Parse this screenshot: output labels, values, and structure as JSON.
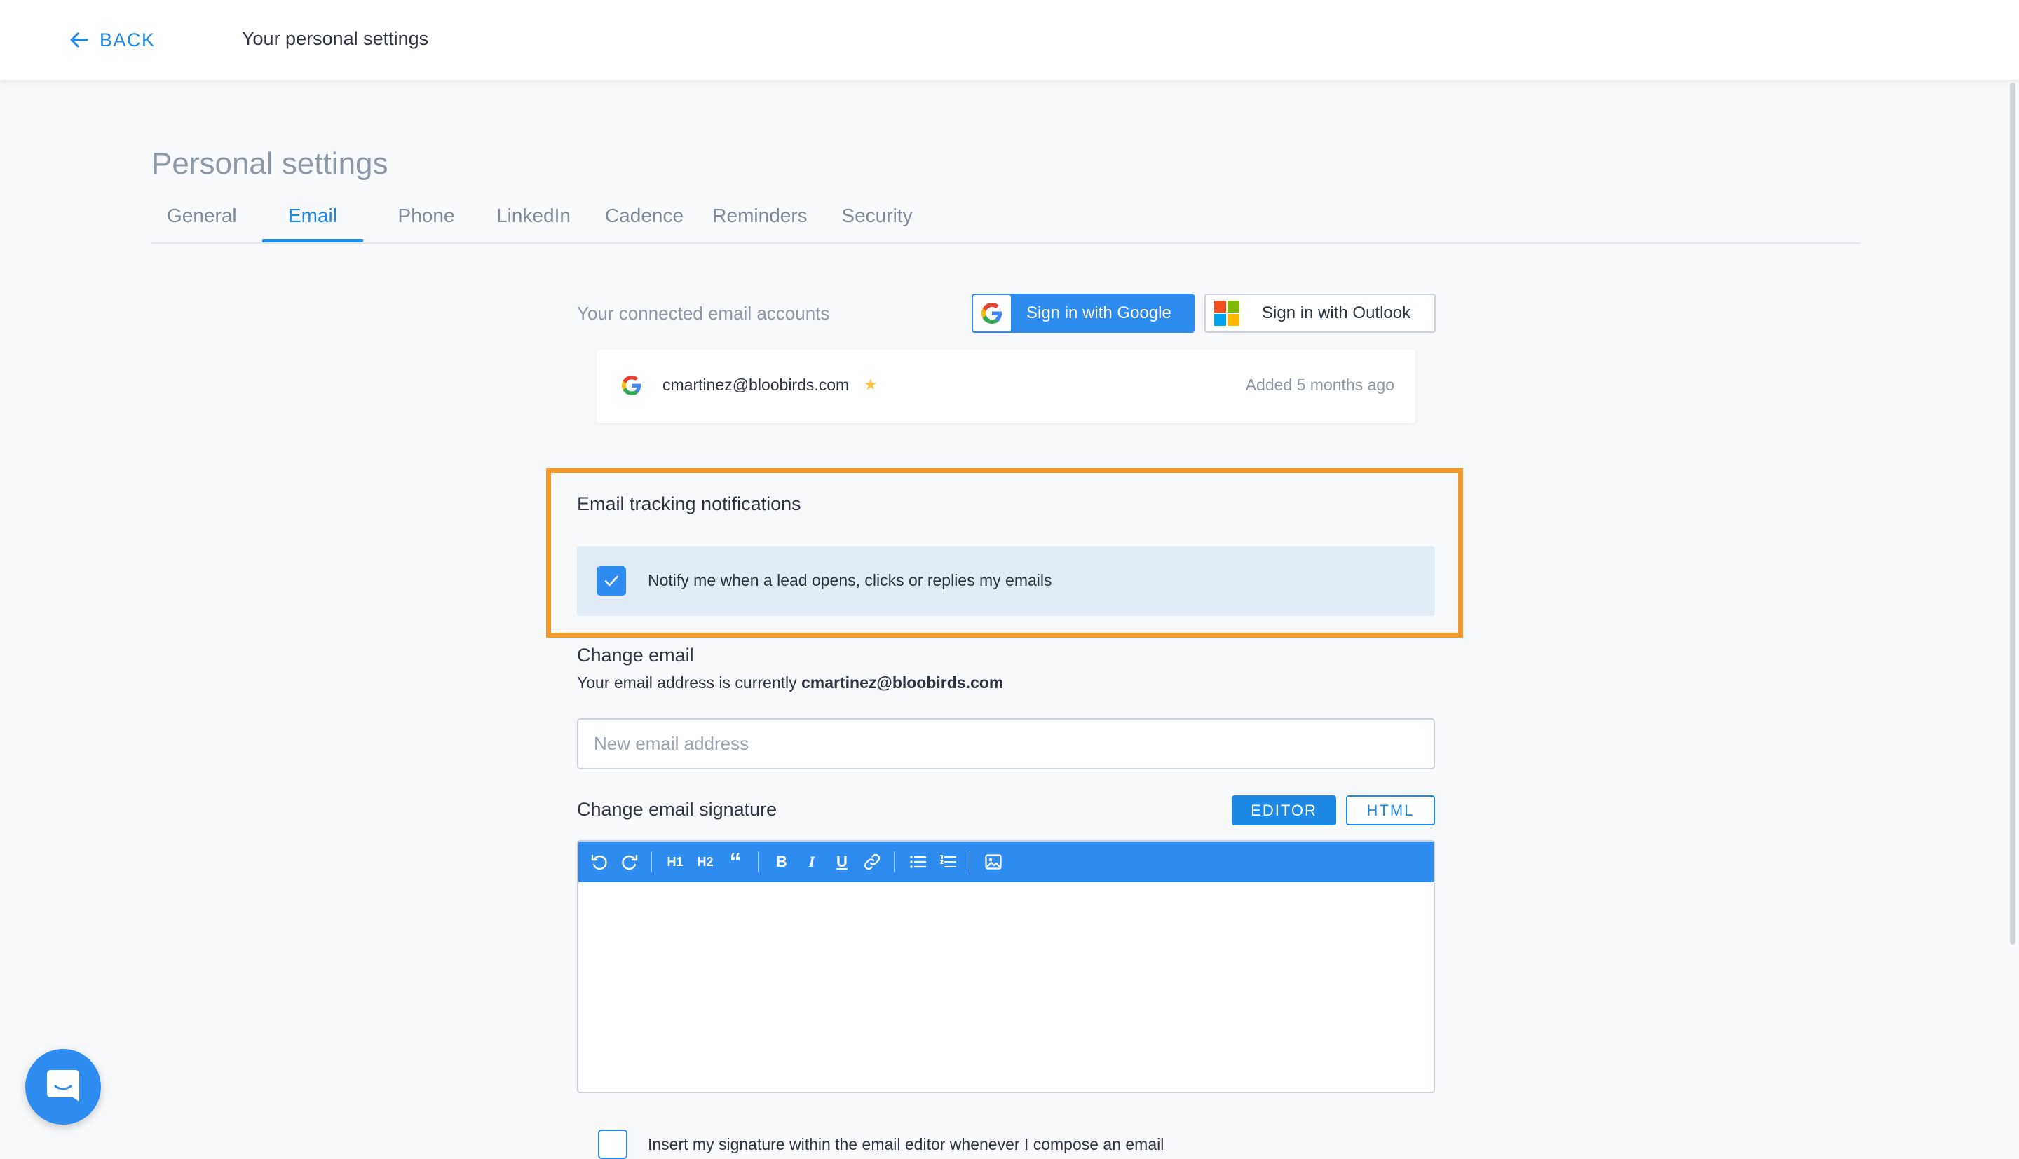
{
  "header": {
    "back_label": "BACK",
    "title": "Your personal settings"
  },
  "page": {
    "title": "Personal settings"
  },
  "tabs": [
    {
      "label": "General",
      "active": false
    },
    {
      "label": "Email",
      "active": true
    },
    {
      "label": "Phone",
      "active": false
    },
    {
      "label": "LinkedIn",
      "active": false
    },
    {
      "label": "Cadence",
      "active": false
    },
    {
      "label": "Reminders",
      "active": false
    },
    {
      "label": "Security",
      "active": false
    }
  ],
  "accounts": {
    "label": "Your connected email accounts",
    "google_button": "Sign in with Google",
    "outlook_button": "Sign in with Outlook",
    "items": [
      {
        "provider": "google",
        "email": "cmartinez@bloobirds.com",
        "primary_icon": "star-icon",
        "added": "Added 5 months ago"
      }
    ]
  },
  "tracking": {
    "title": "Email tracking notifications",
    "option_label": "Notify me when a lead opens, clicks or replies my emails",
    "checked": true
  },
  "change_email": {
    "title": "Change email",
    "desc_prefix": "Your email address is currently ",
    "current_email": "cmartinez@bloobirds.com",
    "placeholder": "New email address",
    "value": ""
  },
  "signature": {
    "title": "Change email signature",
    "editor_button": "EDITOR",
    "html_button": "HTML",
    "mode": "EDITOR",
    "toolbar": [
      "undo-icon",
      "redo-icon",
      "h1-icon",
      "h2-icon",
      "quote-icon",
      "bold-icon",
      "italic-icon",
      "underline-icon",
      "link-icon",
      "bulleted-list-icon",
      "numbered-list-icon",
      "image-icon"
    ],
    "toolbar_text": {
      "h1": "H1",
      "h2": "H2",
      "quote": "“",
      "bold": "B",
      "italic": "I",
      "underline": "U"
    },
    "insert_label": "Insert my signature within the email editor whenever I compose an email",
    "insert_checked": false
  },
  "colors": {
    "accent": "#1e88e5",
    "highlight": "#f59a2e",
    "background": "#f8f9fb"
  },
  "chat": {
    "icon": "chat-icon"
  }
}
